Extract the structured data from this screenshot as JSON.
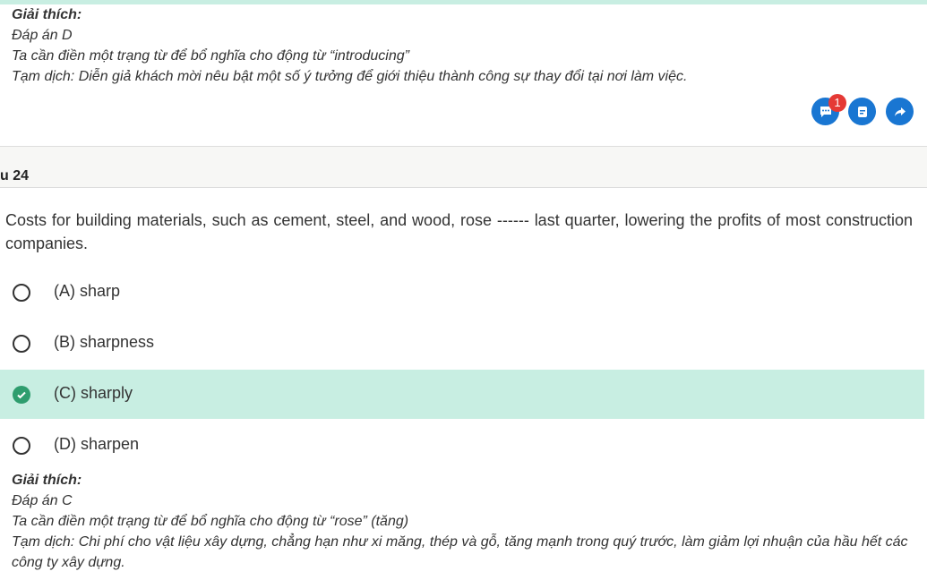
{
  "prev_explanation": {
    "title": "Giải thích:",
    "answer": "Đáp án D",
    "reason": "Ta cần điền một trạng từ để bổ nghĩa cho động từ “introducing”",
    "translation": "Tạm dịch: Diễn giả khách mời nêu bật một số ý tưởng để giới thiệu thành công sự thay đổi tại nơi làm việc."
  },
  "actions": {
    "comment_badge": "1",
    "icons": [
      "comment-icon",
      "note-icon",
      "share-icon"
    ],
    "color": "#1976d2"
  },
  "question": {
    "label": "u 24",
    "text": "Costs for building materials, such as cement, steel, and wood, rose ------ last quarter, lowering the profits of most construction companies.",
    "options": [
      {
        "label": "(A) sharp",
        "selected": false
      },
      {
        "label": "(B) sharpness",
        "selected": false
      },
      {
        "label": "(C) sharply",
        "selected": true
      },
      {
        "label": "(D) sharpen",
        "selected": false
      }
    ],
    "selected_color": "#c8eee2"
  },
  "explanation": {
    "title": "Giải thích:",
    "answer": "Đáp án C",
    "reason": "Ta cần điền một trạng từ để bổ nghĩa cho động từ “rose” (tăng)",
    "translation": "Tạm dịch: Chi phí cho vật liệu xây dựng, chẳng hạn như xi măng, thép và gỗ, tăng mạnh trong quý trước, làm giảm lợi nhuận của hầu hết các công ty xây dựng."
  }
}
